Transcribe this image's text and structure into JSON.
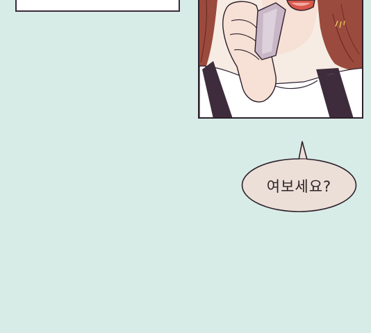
{
  "bubble": {
    "text": "여보세요?"
  },
  "colors": {
    "background": "#d8ece7",
    "bubble_fill": "#ecdfd7",
    "outline": "#2b1f2b",
    "hair": "#9b4a3e",
    "skin": "#f7e0d5"
  }
}
